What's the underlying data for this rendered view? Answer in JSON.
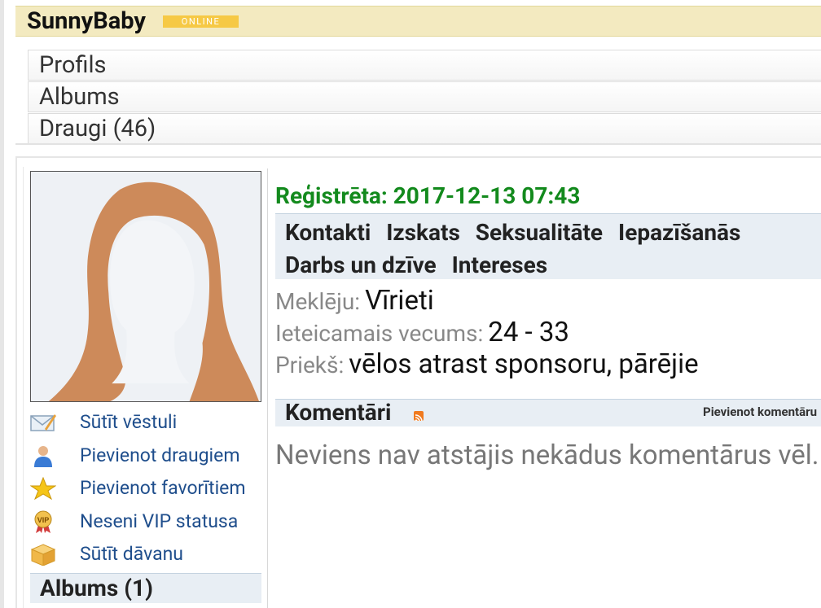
{
  "header": {
    "username": "SunnyBaby",
    "status_badge": "ONLINE"
  },
  "tabs": [
    {
      "label": "Profils"
    },
    {
      "label": "Albums"
    },
    {
      "label": "Draugi (46)"
    }
  ],
  "sidebar": {
    "actions": [
      {
        "label": "Sūtīt vēstuli",
        "icon": "envelope-icon"
      },
      {
        "label": "Pievienot draugiem",
        "icon": "user-icon"
      },
      {
        "label": "Pievienot favorītiem",
        "icon": "star-icon"
      },
      {
        "label": "Neseni VIP statusa",
        "icon": "vip-medal-icon"
      },
      {
        "label": "Sūtīt dāvanu",
        "icon": "gift-box-icon"
      }
    ],
    "albums_heading": "Albums (1)"
  },
  "profile": {
    "registered": "Reģistrēta: 2017-12-13 07:43",
    "info_tabs": [
      "Kontakti",
      "Izskats",
      "Seksualitāte",
      "Iepazīšanās",
      "Darbs un dzīve",
      "Intereses"
    ],
    "fields": [
      {
        "label": "Meklēju:",
        "value": "Vīrieti"
      },
      {
        "label": "Ieteicamais vecums:",
        "value": "24 - 33"
      },
      {
        "label": "Priekš:",
        "value": "vēlos atrast sponsoru, pārējie"
      }
    ]
  },
  "comments": {
    "title": "Komentāri",
    "add_link": "Pievienot komentāru",
    "empty_text": "Neviens nav atstājis nekādus komentārus vēl."
  },
  "colors": {
    "accent_green": "#138a1d",
    "link_blue": "#1f4e8c",
    "badge_yellow": "#f6c945",
    "header_bg": "#f3eac0",
    "avatar_hair": "#cd8a5a"
  }
}
